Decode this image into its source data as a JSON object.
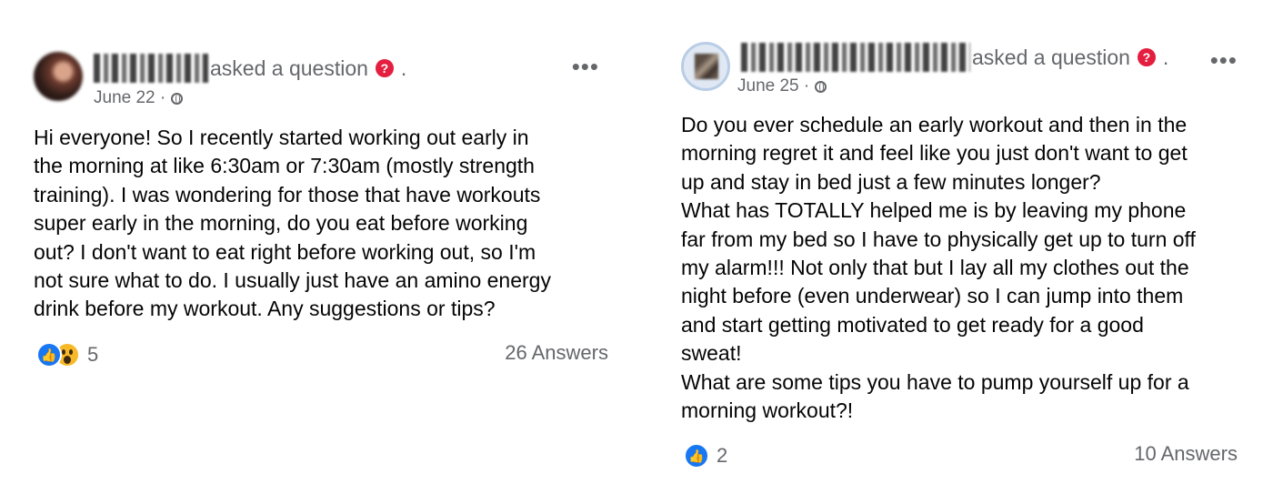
{
  "posts": [
    {
      "action": "asked a question",
      "date": "June 22 ·",
      "body": "Hi everyone! So I recently started working out early in\nthe morning at like 6:30am or 7:30am (mostly strength\ntraining). I was wondering for those that have workouts\nsuper early in the morning, do you eat before working\nout? I don't want to eat right before working out, so I'm\nnot sure what to do. I usually just have an amino energy\ndrink before my workout. Any suggestions or tips?",
      "reactions": [
        "like",
        "wow"
      ],
      "reaction_count": "5",
      "answers": "26 Answers"
    },
    {
      "action": "asked a question",
      "date": "June 25 ·",
      "body": "Do you ever schedule an early workout and then in the\nmorning regret it and feel like you just don't want to get\nup and stay in bed just a few minutes longer?\nWhat has TOTALLY helped me is by leaving my phone\nfar from my bed so I have to physically get up to turn off\nmy alarm!!! Not only that but I lay all my clothes out the\nnight before (even underwear) so I can jump into them\nand start getting motivated to get ready for a good\nsweat!\nWhat are some tips you have to pump yourself up for a\nmorning workout?!",
      "reactions": [
        "like"
      ],
      "reaction_count": "2",
      "answers": "10 Answers"
    }
  ],
  "icons": {
    "question_badge": "?",
    "more": "•••",
    "like": "👍"
  },
  "colors": {
    "meta_text": "#65676b",
    "like_blue": "#1877f2",
    "question_red": "#e41e3f",
    "wow_yellow": "#f7b928"
  }
}
